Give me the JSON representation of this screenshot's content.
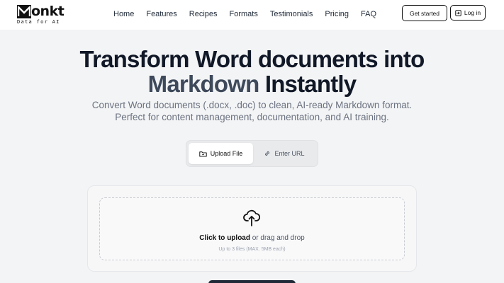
{
  "brand": {
    "name": "onkt",
    "tagline": "Data for AI"
  },
  "nav": {
    "items": [
      "Home",
      "Features",
      "Recipes",
      "Formats",
      "Testimonials",
      "Pricing",
      "FAQ"
    ]
  },
  "header": {
    "get_started": "Get started",
    "login": "Log in"
  },
  "hero": {
    "title_line1": "Transform Word documents into",
    "title_accent": "Markdown",
    "title_rest": " Instantly",
    "subtitle_line1": "Convert Word documents (.docx, .doc) to clean, AI-ready Markdown format.",
    "subtitle_line2": "Perfect for content management, documentation, and AI training."
  },
  "tabs": {
    "upload": "Upload File",
    "url": "Enter URL"
  },
  "dropzone": {
    "click_text": "Click to upload",
    "rest_text": " or drag and drop",
    "limit": "Up to 3 files (MAX. 5MB each)"
  },
  "colors": {
    "accent_text": "#3e4a5b",
    "primary": "#111827",
    "background": "#f3f4f5"
  }
}
